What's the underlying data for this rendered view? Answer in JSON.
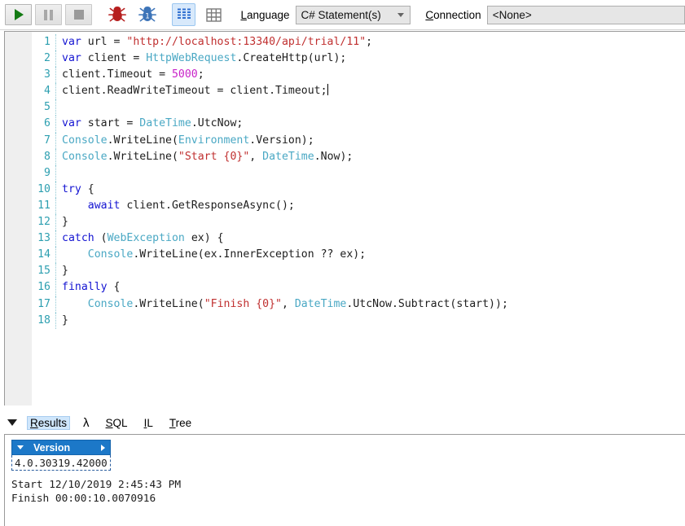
{
  "toolbar": {
    "run_button": "run-query",
    "pause_button": "pause-query",
    "stop_button": "stop-query",
    "debug_red_button": "debug-break-all",
    "debug_blue_button": "debug-step",
    "results_grid_button": "results-to-grids",
    "results_table_button": "results-to-data-grids",
    "language_label_pre": "L",
    "language_label_post": "anguage",
    "language_value": "C# Statement(s)",
    "connection_label_pre": "C",
    "connection_label_post": "onnection",
    "connection_value": "<None>"
  },
  "editor": {
    "caret_line": 4,
    "lines": [
      {
        "n": "1",
        "tokens": [
          {
            "t": "var",
            "c": "kw"
          },
          {
            "t": " url = ",
            "c": "pln"
          },
          {
            "t": "\"http://localhost:13340/api/trial/11\"",
            "c": "str"
          },
          {
            "t": ";",
            "c": "pln"
          }
        ]
      },
      {
        "n": "2",
        "tokens": [
          {
            "t": "var",
            "c": "kw"
          },
          {
            "t": " client = ",
            "c": "pln"
          },
          {
            "t": "HttpWebRequest",
            "c": "typ"
          },
          {
            "t": ".CreateHttp(url);",
            "c": "pln"
          }
        ]
      },
      {
        "n": "3",
        "tokens": [
          {
            "t": "client.Timeout = ",
            "c": "pln"
          },
          {
            "t": "5000",
            "c": "num"
          },
          {
            "t": ";",
            "c": "pln"
          }
        ]
      },
      {
        "n": "4",
        "tokens": [
          {
            "t": "client.ReadWriteTimeout = client.Timeout;",
            "c": "pln"
          }
        ]
      },
      {
        "n": "5",
        "tokens": []
      },
      {
        "n": "6",
        "tokens": [
          {
            "t": "var",
            "c": "kw"
          },
          {
            "t": " start = ",
            "c": "pln"
          },
          {
            "t": "DateTime",
            "c": "typ"
          },
          {
            "t": ".UtcNow;",
            "c": "pln"
          }
        ]
      },
      {
        "n": "7",
        "tokens": [
          {
            "t": "Console",
            "c": "typ"
          },
          {
            "t": ".WriteLine(",
            "c": "pln"
          },
          {
            "t": "Environment",
            "c": "typ"
          },
          {
            "t": ".Version);",
            "c": "pln"
          }
        ]
      },
      {
        "n": "8",
        "tokens": [
          {
            "t": "Console",
            "c": "typ"
          },
          {
            "t": ".WriteLine(",
            "c": "pln"
          },
          {
            "t": "\"Start {0}\"",
            "c": "str"
          },
          {
            "t": ", ",
            "c": "pln"
          },
          {
            "t": "DateTime",
            "c": "typ"
          },
          {
            "t": ".Now);",
            "c": "pln"
          }
        ]
      },
      {
        "n": "9",
        "tokens": []
      },
      {
        "n": "10",
        "tokens": [
          {
            "t": "try",
            "c": "kw"
          },
          {
            "t": " {",
            "c": "pln"
          }
        ]
      },
      {
        "n": "11",
        "tokens": [
          {
            "t": "    ",
            "c": "pln"
          },
          {
            "t": "await",
            "c": "kw"
          },
          {
            "t": " client.GetResponseAsync();",
            "c": "pln"
          }
        ]
      },
      {
        "n": "12",
        "tokens": [
          {
            "t": "}",
            "c": "pln"
          }
        ]
      },
      {
        "n": "13",
        "tokens": [
          {
            "t": "catch",
            "c": "kw"
          },
          {
            "t": " (",
            "c": "pln"
          },
          {
            "t": "WebException",
            "c": "typ"
          },
          {
            "t": " ex) {",
            "c": "pln"
          }
        ]
      },
      {
        "n": "14",
        "tokens": [
          {
            "t": "    ",
            "c": "pln"
          },
          {
            "t": "Console",
            "c": "typ"
          },
          {
            "t": ".WriteLine(ex.InnerException ?? ex);",
            "c": "pln"
          }
        ]
      },
      {
        "n": "15",
        "tokens": [
          {
            "t": "}",
            "c": "pln"
          }
        ]
      },
      {
        "n": "16",
        "tokens": [
          {
            "t": "finally",
            "c": "kw"
          },
          {
            "t": " {",
            "c": "pln"
          }
        ]
      },
      {
        "n": "17",
        "tokens": [
          {
            "t": "    ",
            "c": "pln"
          },
          {
            "t": "Console",
            "c": "typ"
          },
          {
            "t": ".WriteLine(",
            "c": "pln"
          },
          {
            "t": "\"Finish {0}\"",
            "c": "str"
          },
          {
            "t": ", ",
            "c": "pln"
          },
          {
            "t": "DateTime",
            "c": "typ"
          },
          {
            "t": ".UtcNow.Subtract(start));",
            "c": "pln"
          }
        ]
      },
      {
        "n": "18",
        "tokens": [
          {
            "t": "}",
            "c": "pln"
          }
        ]
      }
    ]
  },
  "tabs": {
    "collapse": "collapse-results",
    "items": [
      {
        "pre": "R",
        "post": "esults",
        "active": true,
        "name": "tab-results"
      },
      {
        "pre": "",
        "post": "λ",
        "active": false,
        "name": "tab-lambda"
      },
      {
        "pre": "S",
        "post": "QL",
        "active": false,
        "name": "tab-sql"
      },
      {
        "pre": "I",
        "post": "L",
        "active": false,
        "name": "tab-il"
      },
      {
        "pre": "T",
        "post": "ree",
        "active": false,
        "name": "tab-tree"
      }
    ]
  },
  "results": {
    "grid": {
      "column_header": "Version",
      "cell_value": "4.0.30319.42000"
    },
    "console_output": "Start 12/10/2019 2:45:43 PM\nFinish 00:00:10.0070916"
  },
  "colors": {
    "keyword": "#1414d2",
    "type": "#4aa8c4",
    "string": "#c03030",
    "number": "#c822c8",
    "plain": "#1d1d1d",
    "line_number": "#2d9fb0",
    "grid_header_bg": "#1c78c8",
    "tab_active_bg": "#cfe6fb",
    "run_green": "#137a13",
    "bug_red": "#b61f1f",
    "bug_blue": "#3d74b8"
  }
}
